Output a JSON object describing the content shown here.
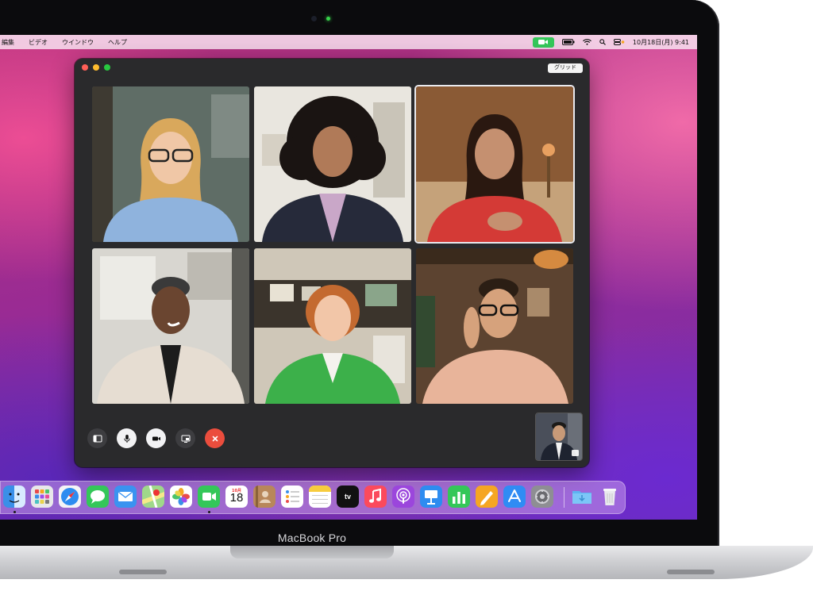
{
  "menubar": {
    "items": [
      "編集",
      "ビデオ",
      "ウインドウ",
      "ヘルプ"
    ],
    "clock": "10月18日(月) 9:41"
  },
  "facetime": {
    "layout_button": "グリッド",
    "participants": [
      {
        "id": "p1",
        "shirt": "#8fb3dd",
        "hair": "#d9a85c",
        "skin": "#f0c7a6",
        "bg": "#6d7a73"
      },
      {
        "id": "p2",
        "shirt": "#262a3a",
        "hair": "#1a1412",
        "skin": "#b07a58",
        "bg": "#e9e6df"
      },
      {
        "id": "p3",
        "shirt": "#d43a36",
        "hair": "#2a1810",
        "skin": "#c59070",
        "bg": "#8a5a35"
      },
      {
        "id": "p4",
        "shirt": "#e6ddd2",
        "hair": "#3a3a3a",
        "skin": "#6a4530",
        "bg": "#d8d6d0"
      },
      {
        "id": "p5",
        "shirt": "#3cb04a",
        "hair": "#c46a30",
        "skin": "#f2c6a8",
        "bg": "#cfc7b8"
      },
      {
        "id": "p6",
        "shirt": "#e8b49a",
        "hair": "#2b1e14",
        "skin": "#d6a27c",
        "bg": "#5c4330"
      }
    ]
  },
  "dock": {
    "calendar_month": "10月",
    "calendar_day": "18",
    "tv_label": "tv"
  },
  "device": {
    "brand": "MacBook Pro"
  }
}
